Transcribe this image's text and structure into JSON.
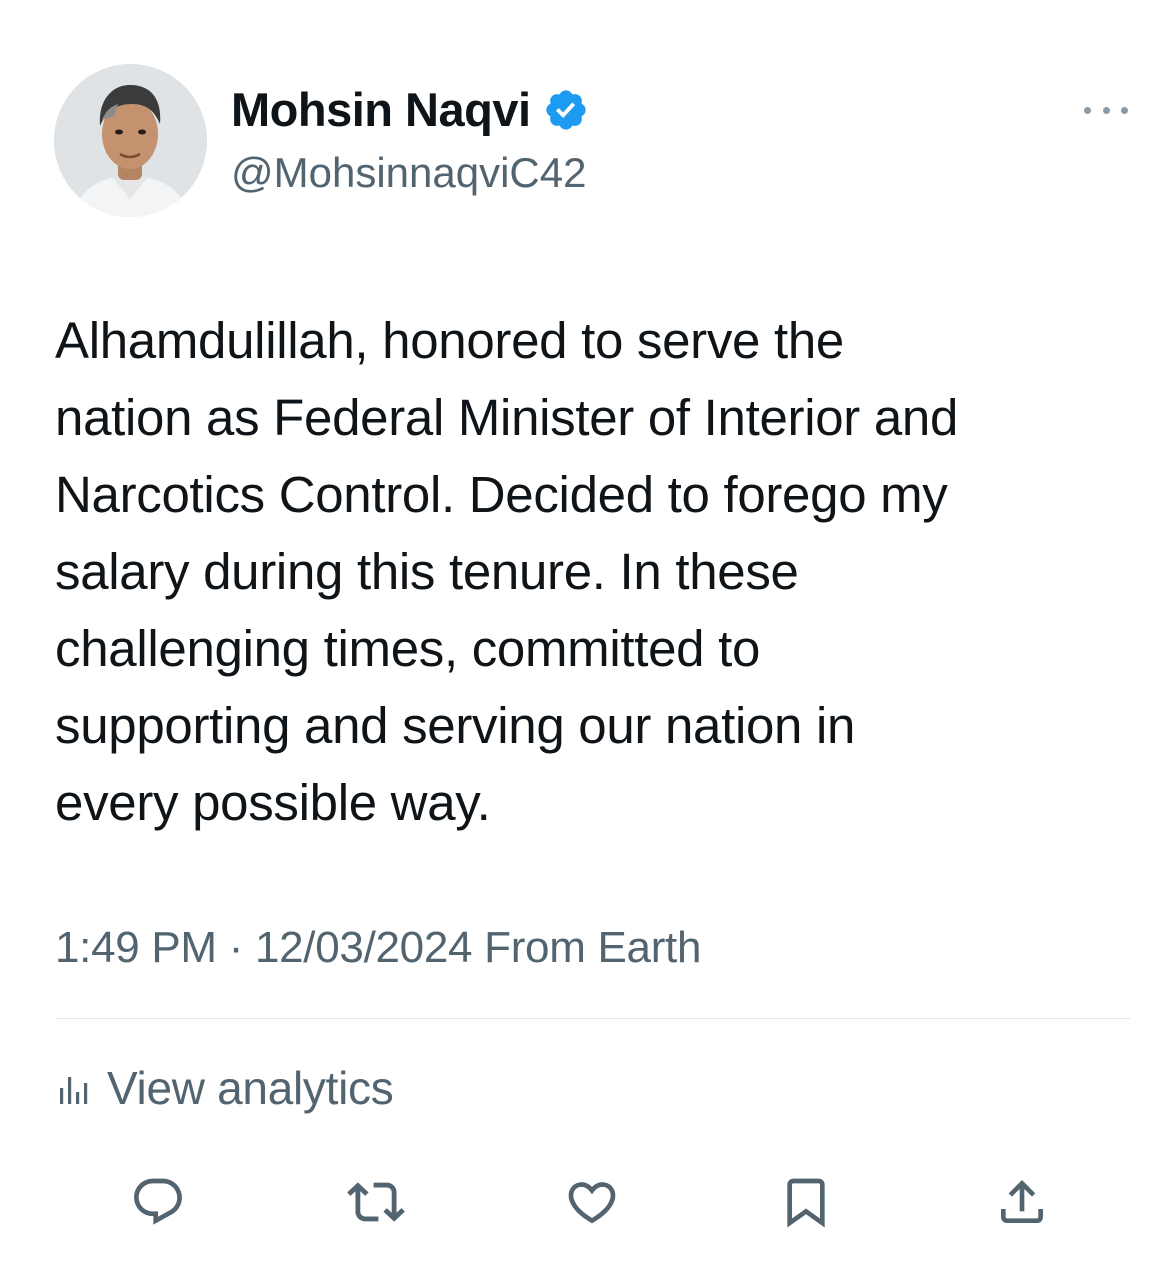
{
  "tweet": {
    "author": {
      "display_name": "Mohsin Naqvi",
      "handle": "@MohsinnaqviC42",
      "verified": true
    },
    "text": "Alhamdulillah, honored to serve the\nnation as Federal Minister of Interior and\nNarcotics Control. Decided to forego my\nsalary during this tenure. In these\nchallenging times, committed to\nsupporting and serving our nation in\nevery possible way.",
    "time": "1:49 PM",
    "separator": " · ",
    "date": "12/03/2024",
    "source": " From Earth",
    "analytics_label": "View analytics"
  },
  "icons": {
    "verified": "verified-badge-icon",
    "more": "more-horizontal-icon",
    "analytics": "bar-chart-icon",
    "reply": "reply-bubble-icon",
    "retweet": "retweet-icon",
    "like": "heart-icon",
    "bookmark": "bookmark-icon",
    "share": "share-upload-icon"
  },
  "colors": {
    "text_primary": "#0f1419",
    "text_secondary": "#536471",
    "verified_blue": "#1d9bf0",
    "divider": "#e1e6ea"
  }
}
